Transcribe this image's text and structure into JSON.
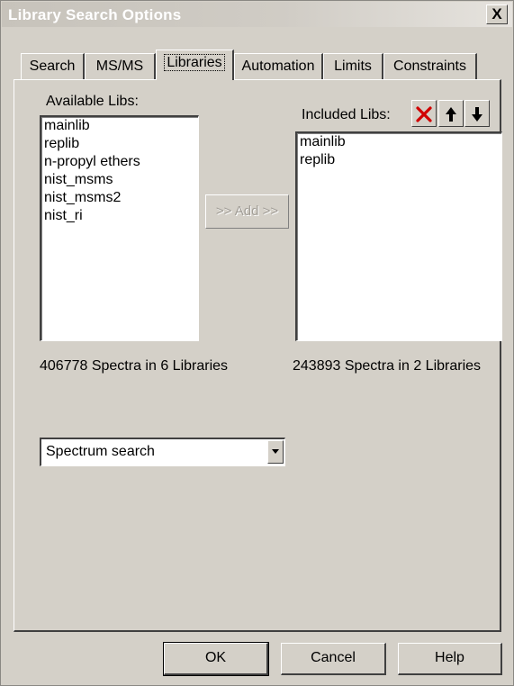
{
  "window": {
    "title": "Library Search Options",
    "close_label": "X"
  },
  "tabs": [
    {
      "label": "Search",
      "active": false
    },
    {
      "label": "MS/MS",
      "active": false
    },
    {
      "label": "Libraries",
      "active": true
    },
    {
      "label": "Automation",
      "active": false
    },
    {
      "label": "Limits",
      "active": false
    },
    {
      "label": "Constraints",
      "active": false
    }
  ],
  "available": {
    "label": "Available Libs:",
    "items": [
      "mainlib",
      "replib",
      "n-propyl ethers",
      "nist_msms",
      "nist_msms2",
      "nist_ri"
    ],
    "summary": "406778 Spectra in 6 Libraries"
  },
  "add_button": {
    "label": ">> Add >>",
    "enabled": false
  },
  "included": {
    "label": "Included Libs:",
    "items": [
      "mainlib",
      "replib"
    ],
    "summary": "243893 Spectra in 2 Libraries",
    "tools": {
      "remove_icon": "red-x-icon",
      "move_up_icon": "arrow-up-icon",
      "move_down_icon": "arrow-down-icon",
      "remove_color": "#d10000"
    }
  },
  "search_type": {
    "selected": "Spectrum search"
  },
  "footer": {
    "ok_label": "OK",
    "cancel_label": "Cancel",
    "help_label": "Help"
  }
}
